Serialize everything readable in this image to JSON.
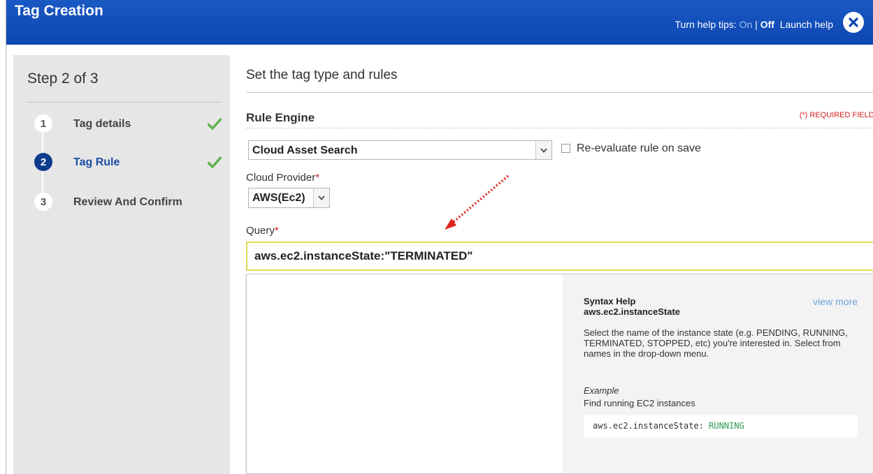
{
  "dialog": {
    "title": "Tag Creation",
    "help_tips_prefix": "Turn help tips: ",
    "help_on": "On",
    "help_separator": " | ",
    "help_off": "Off",
    "launch_help": "Launch help",
    "close_icon": "close-x-icon",
    "title_color": "#0d47b1"
  },
  "wizard": {
    "step_label": "Step 2 of 3",
    "steps": [
      {
        "number": "1",
        "label": "Tag details",
        "completed": true,
        "active": false
      },
      {
        "number": "2",
        "label": "Tag Rule",
        "completed": true,
        "active": true
      },
      {
        "number": "3",
        "label": "Review And Confirm",
        "completed": false,
        "active": false
      }
    ]
  },
  "main": {
    "heading": "Set the tag type and rules",
    "section_title": "Rule Engine",
    "required_note": "(*) REQUIRED FIELDS",
    "rule_engine_value": "Cloud Asset Search",
    "reevaluate_label": "Re-evaluate rule on save",
    "reevaluate_checked": false,
    "cloud_provider_label": "Cloud Provider",
    "cloud_provider_value": "AWS(Ec2)",
    "query_label": "Query",
    "required_star": "*",
    "query_value": "aws.ec2.instanceState:\"TERMINATED\""
  },
  "syntax_help": {
    "title": "Syntax Help",
    "field": "aws.ec2.instanceState",
    "view_more": "view more",
    "description": "Select the name of the instance state (e.g. PENDING, RUNNING, TERMINATED, STOPPED, etc) you're interested in. Select from names in the drop-down menu.",
    "example_label": "Example",
    "example_desc": "Find running EC2 instances",
    "code_prefix": "aws.ec2.instanceState: ",
    "code_value": "RUNNING"
  },
  "colors": {
    "accent": "#0d47b1",
    "required": "#d42020",
    "check": "#5fb04a",
    "link": "#6ea3dd",
    "annotation_arrow": "#e0241c"
  }
}
